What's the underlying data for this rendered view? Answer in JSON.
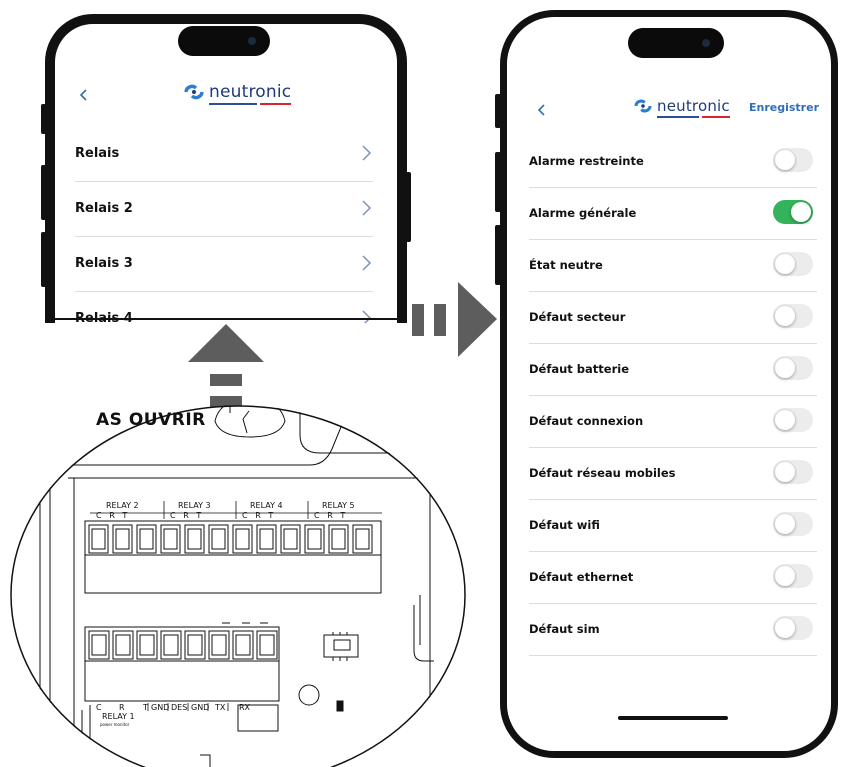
{
  "left_phone": {
    "back_icon": "chevron-left",
    "logo_text": "neutronic",
    "items": [
      {
        "label": "Relais"
      },
      {
        "label": "Relais 2"
      },
      {
        "label": "Relais 3"
      },
      {
        "label": "Relais 4"
      }
    ]
  },
  "board": {
    "warning_text": "AS OUVRIR",
    "relay_groups": [
      {
        "label": "RELAY 2",
        "pins": "C   R   T"
      },
      {
        "label": "RELAY 3",
        "pins": "C   R   T"
      },
      {
        "label": "RELAY 4",
        "pins": "C   R   T"
      },
      {
        "label": "RELAY 5",
        "pins": "C   R   T"
      }
    ],
    "bottom_pins": [
      "C",
      "R",
      "T",
      "GND",
      "DES",
      "GND",
      "TX",
      "RX"
    ],
    "relay1_label": "RELAY 1",
    "relay1_sub": "power monitor"
  },
  "right_phone": {
    "back_icon": "chevron-left",
    "logo_text": "neutronic",
    "save_label": "Enregistrer",
    "options": [
      {
        "label": "Alarme restreinte",
        "on": false
      },
      {
        "label": "Alarme générale",
        "on": true
      },
      {
        "label": "État neutre",
        "on": false
      },
      {
        "label": "Défaut secteur",
        "on": false
      },
      {
        "label": "Défaut batterie",
        "on": false
      },
      {
        "label": "Défaut connexion",
        "on": false
      },
      {
        "label": "Défaut réseau mobiles",
        "on": false
      },
      {
        "label": "Défaut wifi",
        "on": false
      },
      {
        "label": "Défaut ethernet",
        "on": false
      },
      {
        "label": "Défaut sim",
        "on": false
      }
    ]
  },
  "colors": {
    "accent": "#2f6fb8",
    "toggle_on": "#34b35a",
    "logo_blue": "#1e3b78",
    "logo_red": "#d6262f",
    "arrow_grey": "#5d5d5d"
  }
}
